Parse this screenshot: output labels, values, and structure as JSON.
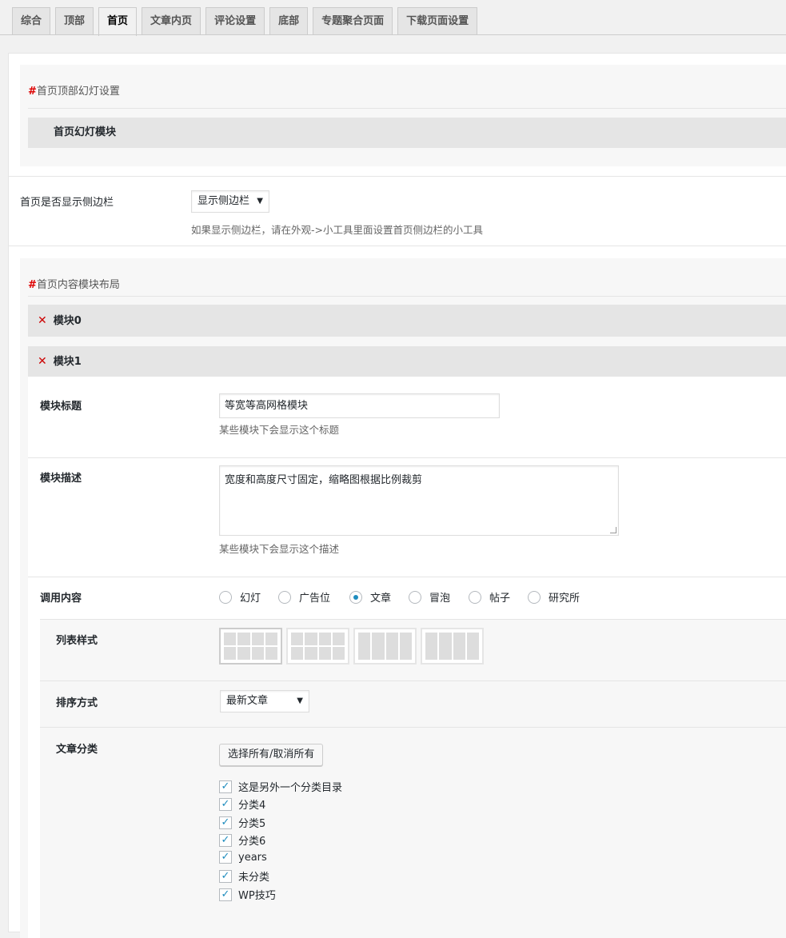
{
  "tabs": [
    "综合",
    "顶部",
    "首页",
    "文章内页",
    "评论设置",
    "底部",
    "专题聚合页面",
    "下载页面设置"
  ],
  "active_tab": "首页",
  "slider_section": {
    "hash": "#",
    "title": "首页顶部幻灯设置",
    "module_title": "首页幻灯模块"
  },
  "sidebar": {
    "label": "首页是否显示侧边栏",
    "selected": "显示侧边栏",
    "description": "如果显示侧边栏，请在外观->小工具里面设置首页侧边栏的小工具"
  },
  "layout_section": {
    "hash": "#",
    "title": "首页内容模块布局"
  },
  "module0": {
    "label": "模块0"
  },
  "module1": {
    "label": "模块1",
    "title_label": "模块标题",
    "title_value": "等宽等高网格模块",
    "title_desc": "某些模块下会显示这个标题",
    "desc_label": "模块描述",
    "desc_value": "宽度和高度尺寸固定，缩略图根据比例裁剪",
    "desc_desc": "某些模块下会显示这个描述",
    "content_label": "调用内容",
    "content_options": [
      "幻灯",
      "广告位",
      "文章",
      "冒泡",
      "帖子",
      "研究所"
    ],
    "content_selected": "文章",
    "list_style_label": "列表样式",
    "order_label": "排序方式",
    "order_selected": "最新文章",
    "category_label": "文章分类",
    "select_all_button": "选择所有/取消所有",
    "categories": [
      "这是另外一个分类目录",
      "分类4",
      "分类5",
      "分类6",
      "years",
      "未分类",
      "WP技巧"
    ]
  },
  "icons": {
    "remove": "close-icon",
    "dropdown": "chevron-down-icon",
    "check": "checkmark-icon"
  },
  "colors": {
    "remove": "#cc0000",
    "hash": "#dd0000",
    "radio_on": "#1e8cbe"
  }
}
